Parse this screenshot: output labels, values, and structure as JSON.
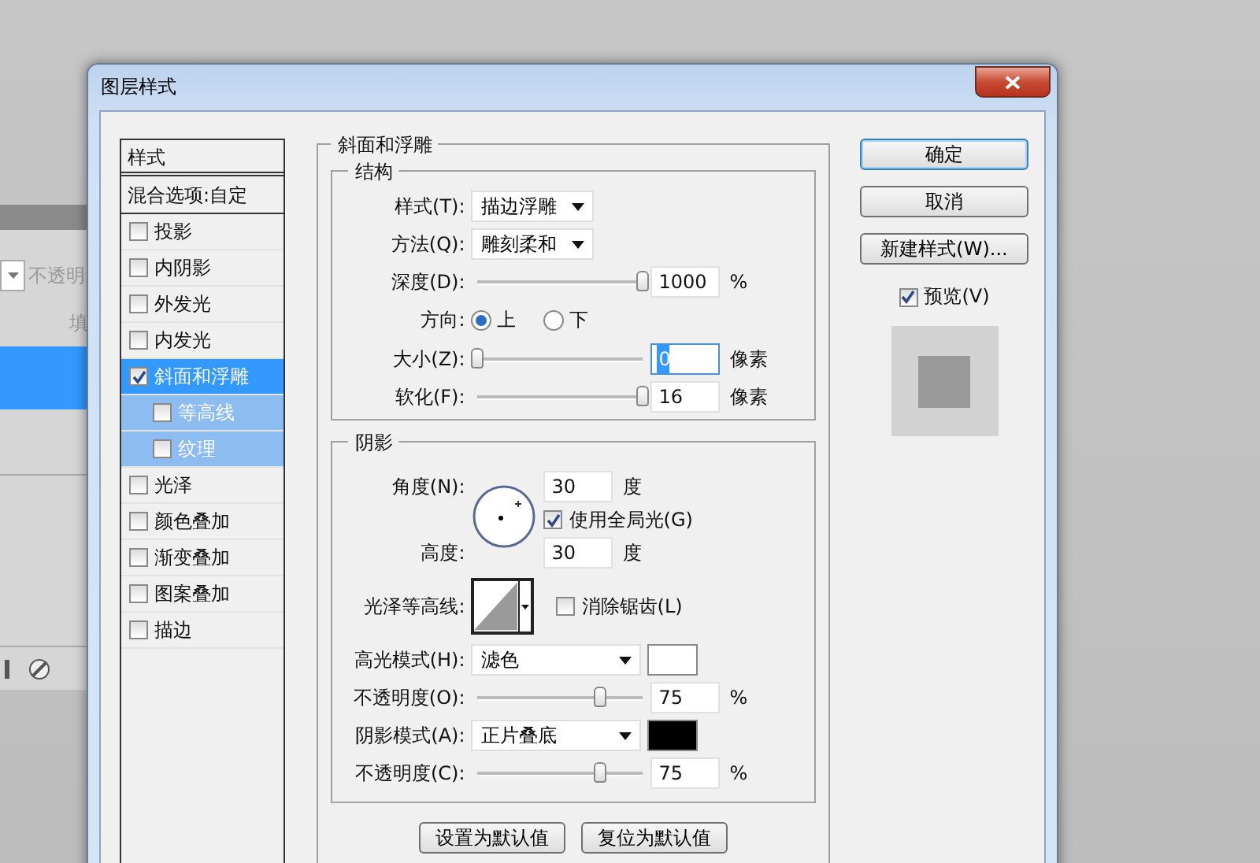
{
  "background_panel": {
    "opacity_label": "不透明",
    "column_label": "填"
  },
  "window": {
    "title": "图层样式"
  },
  "styles_list": {
    "header": "样式",
    "blending": "混合选项:自定",
    "items": [
      {
        "label": "投影",
        "checked": false,
        "selected": false
      },
      {
        "label": "内阴影",
        "checked": false,
        "selected": false
      },
      {
        "label": "外发光",
        "checked": false,
        "selected": false
      },
      {
        "label": "内发光",
        "checked": false,
        "selected": false
      },
      {
        "label": "斜面和浮雕",
        "checked": true,
        "selected": true,
        "children": [
          {
            "label": "等高线",
            "checked": false,
            "selected": false
          },
          {
            "label": "纹理",
            "checked": false,
            "selected": false
          }
        ]
      },
      {
        "label": "光泽",
        "checked": false,
        "selected": false
      },
      {
        "label": "颜色叠加",
        "checked": false,
        "selected": false
      },
      {
        "label": "渐变叠加",
        "checked": false,
        "selected": false
      },
      {
        "label": "图案叠加",
        "checked": false,
        "selected": false
      },
      {
        "label": "描边",
        "checked": false,
        "selected": false
      }
    ]
  },
  "bevel": {
    "title": "斜面和浮雕",
    "structure": {
      "title": "结构",
      "rows": [
        {
          "kind": "dropdown",
          "label": "样式(T):",
          "value": "描边浮雕"
        },
        {
          "kind": "dropdown",
          "label": "方法(Q):",
          "value": "雕刻柔和"
        },
        {
          "kind": "slider",
          "label": "深度(D):",
          "level": 1,
          "value": "1000",
          "unit": "%",
          "focused": false
        },
        {
          "kind": "radio",
          "label": "方向:",
          "options": [
            {
              "label": "上",
              "selected": true
            },
            {
              "label": "下",
              "selected": false
            }
          ]
        },
        {
          "kind": "slider",
          "label": "大小(Z):",
          "level": 0,
          "value": "0",
          "unit": "像素",
          "focused": true
        },
        {
          "kind": "slider",
          "label": "软化(F):",
          "level": 1,
          "value": "16",
          "unit": "像素",
          "focused": false
        }
      ]
    },
    "shading": {
      "title": "阴影",
      "angle": {
        "label": "角度(N):",
        "value": "30",
        "unit": "度"
      },
      "global_light": {
        "label": "使用全局光(G)",
        "checked": true
      },
      "altitude": {
        "label": "高度:",
        "value": "30",
        "unit": "度"
      },
      "gloss_contour": {
        "label": "光泽等高线:"
      },
      "anti_alias": {
        "label": "消除锯齿(L)",
        "checked": false
      },
      "rows": [
        {
          "kind": "mode",
          "label": "高光模式(H):",
          "value": "滤色",
          "color": "#ffffff"
        },
        {
          "kind": "slider",
          "label": "不透明度(O):",
          "level": 0.74,
          "value": "75",
          "unit": "%"
        },
        {
          "kind": "mode",
          "label": "阴影模式(A):",
          "value": "正片叠底",
          "color": "#000000"
        },
        {
          "kind": "slider",
          "label": "不透明度(C):",
          "level": 0.74,
          "value": "75",
          "unit": "%"
        }
      ]
    },
    "buttons": [
      "设置为默认值",
      "复位为默认值"
    ]
  },
  "actions": [
    {
      "label": "确定",
      "default": true
    },
    {
      "label": "取消",
      "default": false
    },
    {
      "label": "新建样式(W)...",
      "default": false
    }
  ],
  "preview": {
    "label": "预览(V)",
    "checked": true
  }
}
